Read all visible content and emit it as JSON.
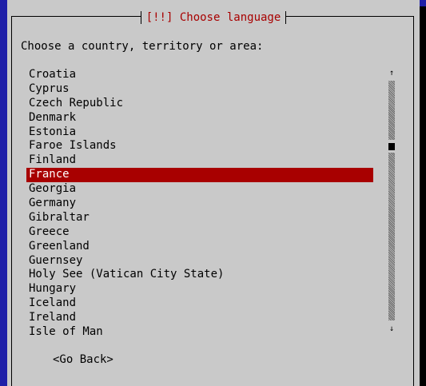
{
  "dialog": {
    "title": "[!!] Choose language",
    "prompt": "Choose a country, territory or area:",
    "items": [
      "Croatia",
      "Cyprus",
      "Czech Republic",
      "Denmark",
      "Estonia",
      "Faroe Islands",
      "Finland",
      "France",
      "Georgia",
      "Germany",
      "Gibraltar",
      "Greece",
      "Greenland",
      "Guernsey",
      "Holy See (Vatican City State)",
      "Hungary",
      "Iceland",
      "Ireland",
      "Isle of Man"
    ],
    "selected": "France",
    "back_label": "<Go Back>"
  },
  "scrollbar": {
    "up_arrow": "↑",
    "down_arrow": "↓"
  },
  "colors": {
    "screen_background": "#1f1fa8",
    "dialog_background": "#c9c9c9",
    "title_text": "#a80000",
    "selection_background": "#a80000",
    "selection_text": "#ffffff"
  }
}
